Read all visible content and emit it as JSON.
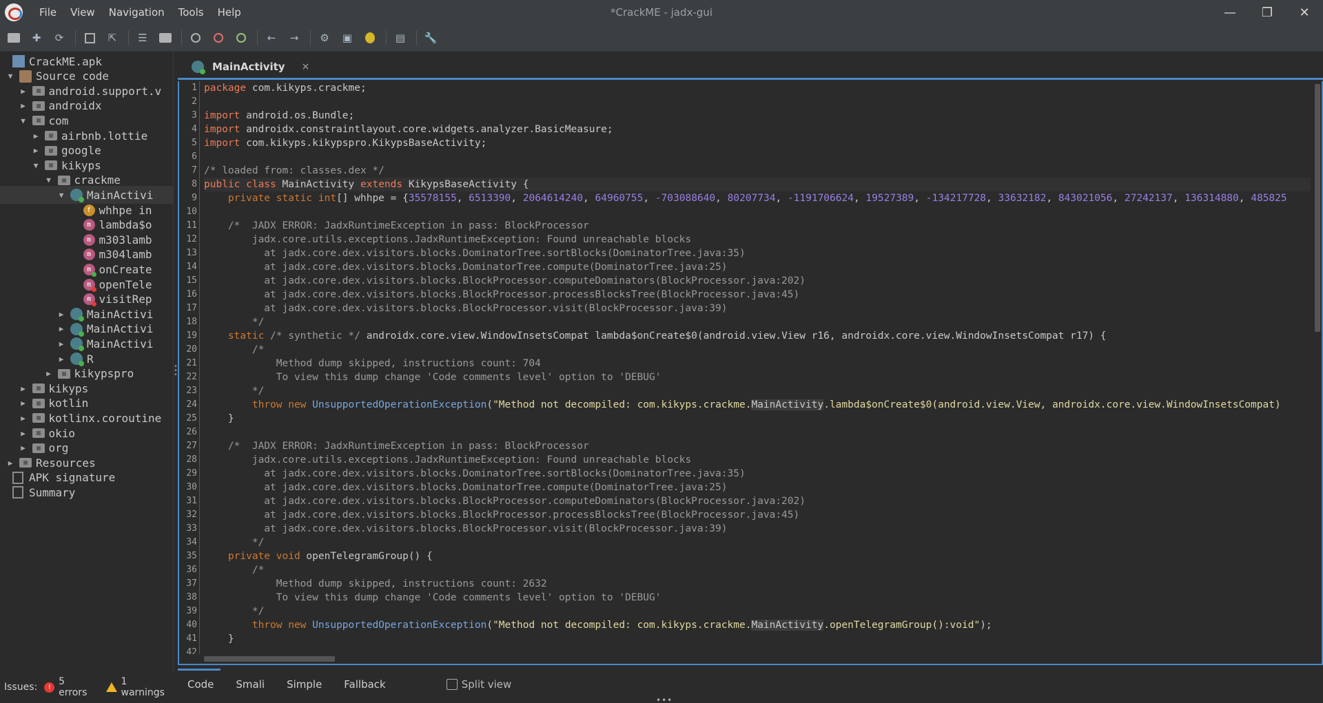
{
  "window": {
    "title": "*CrackME - jadx-gui"
  },
  "menu": [
    "File",
    "View",
    "Navigation",
    "Tools",
    "Help"
  ],
  "tree": [
    {
      "label": "CrackME.apk",
      "indent": 0,
      "arrow": "",
      "icon": "apk"
    },
    {
      "label": "Source code",
      "indent": 0,
      "arrow": "▼",
      "icon": "source"
    },
    {
      "label": "android.support.v",
      "indent": 1,
      "arrow": "▶",
      "icon": "folder"
    },
    {
      "label": "androidx",
      "indent": 1,
      "arrow": "▶",
      "icon": "folder"
    },
    {
      "label": "com",
      "indent": 1,
      "arrow": "▼",
      "icon": "folder"
    },
    {
      "label": "airbnb.lottie",
      "indent": 2,
      "arrow": "▶",
      "icon": "folder"
    },
    {
      "label": "google",
      "indent": 2,
      "arrow": "▶",
      "icon": "folder"
    },
    {
      "label": "kikyps",
      "indent": 2,
      "arrow": "▼",
      "icon": "folder"
    },
    {
      "label": "crackme",
      "indent": 3,
      "arrow": "▼",
      "icon": "folder"
    },
    {
      "label": "MainActivi",
      "indent": 4,
      "arrow": "▼",
      "icon": "class",
      "selected": true
    },
    {
      "label": "whhpe in",
      "indent": 5,
      "arrow": "",
      "icon": "field"
    },
    {
      "label": "lambda$o",
      "indent": 5,
      "arrow": "",
      "icon": "method"
    },
    {
      "label": "m303lamb",
      "indent": 5,
      "arrow": "",
      "icon": "method"
    },
    {
      "label": "m304lamb",
      "indent": 5,
      "arrow": "",
      "icon": "method"
    },
    {
      "label": "onCreate",
      "indent": 5,
      "arrow": "",
      "icon": "method-green"
    },
    {
      "label": "openTele",
      "indent": 5,
      "arrow": "",
      "icon": "method-red"
    },
    {
      "label": "visitRep",
      "indent": 5,
      "arrow": "",
      "icon": "method-red"
    },
    {
      "label": "MainActivi",
      "indent": 4,
      "arrow": "▶",
      "icon": "class"
    },
    {
      "label": "MainActivi",
      "indent": 4,
      "arrow": "▶",
      "icon": "class"
    },
    {
      "label": "MainActivi",
      "indent": 4,
      "arrow": "▶",
      "icon": "class"
    },
    {
      "label": "R",
      "indent": 4,
      "arrow": "▶",
      "icon": "class"
    },
    {
      "label": "kikypspro",
      "indent": 3,
      "arrow": "▶",
      "icon": "folder"
    },
    {
      "label": "kikyps",
      "indent": 1,
      "arrow": "▶",
      "icon": "folder"
    },
    {
      "label": "kotlin",
      "indent": 1,
      "arrow": "▶",
      "icon": "folder"
    },
    {
      "label": "kotlinx.coroutine",
      "indent": 1,
      "arrow": "▶",
      "icon": "folder"
    },
    {
      "label": "okio",
      "indent": 1,
      "arrow": "▶",
      "icon": "folder"
    },
    {
      "label": "org",
      "indent": 1,
      "arrow": "▶",
      "icon": "folder"
    },
    {
      "label": "Resources",
      "indent": 0,
      "arrow": "▶",
      "icon": "folder"
    },
    {
      "label": "APK signature",
      "indent": 0,
      "arrow": "",
      "icon": "doc"
    },
    {
      "label": "Summary",
      "indent": 0,
      "arrow": "",
      "icon": "doc"
    }
  ],
  "tab": {
    "label": "MainActivity",
    "close": "×"
  },
  "code": [
    [
      [
        "kw",
        "package "
      ],
      [
        "",
        "com.kikyps.crackme;"
      ]
    ],
    [],
    [
      [
        "kw",
        "import "
      ],
      [
        "",
        "android.os.Bundle;"
      ]
    ],
    [
      [
        "kw",
        "import "
      ],
      [
        "",
        "androidx.constraintlayout.core.widgets.analyzer.BasicMeasure;"
      ]
    ],
    [
      [
        "kw",
        "import "
      ],
      [
        "",
        "com.kikyps.kikypspro.KikypsBaseActivity;"
      ]
    ],
    [],
    [
      [
        "cmt",
        "/* loaded from: classes.dex */"
      ]
    ],
    [
      [
        "kw",
        "public class "
      ],
      [
        "",
        "MainActivity "
      ],
      [
        "kw",
        "extends "
      ],
      [
        "",
        "KikypsBaseActivity {"
      ]
    ],
    [
      [
        "",
        "    "
      ],
      [
        "kw2",
        "private static "
      ],
      [
        "kw2",
        "int"
      ],
      [
        "",
        "[] whhpe = {"
      ],
      [
        "num",
        "35578155"
      ],
      [
        "",
        ", "
      ],
      [
        "num",
        "6513390"
      ],
      [
        "",
        ", "
      ],
      [
        "num",
        "2064614240"
      ],
      [
        "",
        ", "
      ],
      [
        "num",
        "64960755"
      ],
      [
        "",
        ", "
      ],
      [
        "num",
        "-703088640"
      ],
      [
        "",
        ", "
      ],
      [
        "num",
        "80207734"
      ],
      [
        "",
        ", "
      ],
      [
        "num",
        "-1191706624"
      ],
      [
        "",
        ", "
      ],
      [
        "num",
        "19527389"
      ],
      [
        "",
        ", "
      ],
      [
        "num",
        "-134217728"
      ],
      [
        "",
        ", "
      ],
      [
        "num",
        "33632182"
      ],
      [
        "",
        ", "
      ],
      [
        "num",
        "843021056"
      ],
      [
        "",
        ", "
      ],
      [
        "num",
        "27242137"
      ],
      [
        "",
        ", "
      ],
      [
        "num",
        "136314880"
      ],
      [
        "",
        ", "
      ],
      [
        "num",
        "485825"
      ]
    ],
    [],
    [
      [
        "cmt",
        "    /*  JADX ERROR: JadxRuntimeException in pass: BlockProcessor"
      ]
    ],
    [
      [
        "cmt",
        "        jadx.core.utils.exceptions.JadxRuntimeException: Found unreachable blocks"
      ]
    ],
    [
      [
        "cmt",
        "          at jadx.core.dex.visitors.blocks.DominatorTree.sortBlocks(DominatorTree.java:35)"
      ]
    ],
    [
      [
        "cmt",
        "          at jadx.core.dex.visitors.blocks.DominatorTree.compute(DominatorTree.java:25)"
      ]
    ],
    [
      [
        "cmt",
        "          at jadx.core.dex.visitors.blocks.BlockProcessor.computeDominators(BlockProcessor.java:202)"
      ]
    ],
    [
      [
        "cmt",
        "          at jadx.core.dex.visitors.blocks.BlockProcessor.processBlocksTree(BlockProcessor.java:45)"
      ]
    ],
    [
      [
        "cmt",
        "          at jadx.core.dex.visitors.blocks.BlockProcessor.visit(BlockProcessor.java:39)"
      ]
    ],
    [
      [
        "cmt",
        "        */"
      ]
    ],
    [
      [
        "",
        "    "
      ],
      [
        "kw2",
        "static "
      ],
      [
        "cmt",
        "/* synthetic */ "
      ],
      [
        "",
        "androidx.core.view.WindowInsetsCompat lambda$onCreate$0(android.view.View r16, androidx.core.view.WindowInsetsCompat r17) {"
      ]
    ],
    [
      [
        "cmt",
        "        /*"
      ]
    ],
    [
      [
        "cmt",
        "            Method dump skipped, instructions count: 704"
      ]
    ],
    [
      [
        "cmt",
        "            To view this dump change 'Code comments level' option to 'DEBUG'"
      ]
    ],
    [
      [
        "cmt",
        "        */"
      ]
    ],
    [
      [
        "",
        "        "
      ],
      [
        "kw2",
        "throw new "
      ],
      [
        "typ",
        "UnsupportedOperationException"
      ],
      [
        "",
        "("
      ],
      [
        "str",
        "\"Method not decompiled: com.kikyps.crackme."
      ],
      [
        "mark",
        "MainActivity"
      ],
      [
        "str",
        ".lambda$onCreate$0(android.view.View, androidx.core.view.WindowInsetsCompat)"
      ]
    ],
    [
      [
        "",
        "    }"
      ]
    ],
    [],
    [
      [
        "cmt",
        "    /*  JADX ERROR: JadxRuntimeException in pass: BlockProcessor"
      ]
    ],
    [
      [
        "cmt",
        "        jadx.core.utils.exceptions.JadxRuntimeException: Found unreachable blocks"
      ]
    ],
    [
      [
        "cmt",
        "          at jadx.core.dex.visitors.blocks.DominatorTree.sortBlocks(DominatorTree.java:35)"
      ]
    ],
    [
      [
        "cmt",
        "          at jadx.core.dex.visitors.blocks.DominatorTree.compute(DominatorTree.java:25)"
      ]
    ],
    [
      [
        "cmt",
        "          at jadx.core.dex.visitors.blocks.BlockProcessor.computeDominators(BlockProcessor.java:202)"
      ]
    ],
    [
      [
        "cmt",
        "          at jadx.core.dex.visitors.blocks.BlockProcessor.processBlocksTree(BlockProcessor.java:45)"
      ]
    ],
    [
      [
        "cmt",
        "          at jadx.core.dex.visitors.blocks.BlockProcessor.visit(BlockProcessor.java:39)"
      ]
    ],
    [
      [
        "cmt",
        "        */"
      ]
    ],
    [
      [
        "",
        "    "
      ],
      [
        "kw2",
        "private void "
      ],
      [
        "",
        "openTelegramGroup() {"
      ]
    ],
    [
      [
        "cmt",
        "        /*"
      ]
    ],
    [
      [
        "cmt",
        "            Method dump skipped, instructions count: 2632"
      ]
    ],
    [
      [
        "cmt",
        "            To view this dump change 'Code comments level' option to 'DEBUG'"
      ]
    ],
    [
      [
        "cmt",
        "        */"
      ]
    ],
    [
      [
        "",
        "        "
      ],
      [
        "kw2",
        "throw new "
      ],
      [
        "typ",
        "UnsupportedOperationException"
      ],
      [
        "",
        "("
      ],
      [
        "str",
        "\"Method not decompiled: com.kikyps.crackme."
      ],
      [
        "mark",
        "MainActivity"
      ],
      [
        "str",
        ".openTelegramGroup():void\""
      ],
      [
        "",
        ");"
      ]
    ],
    [
      [
        "",
        "    }"
      ]
    ],
    []
  ],
  "bottom_tabs": [
    "Code",
    "Smali",
    "Simple",
    "Fallback"
  ],
  "split_view_label": "Split view",
  "status": {
    "label": "Issues:",
    "errors": "5 errors",
    "warnings": "1 warnings"
  }
}
